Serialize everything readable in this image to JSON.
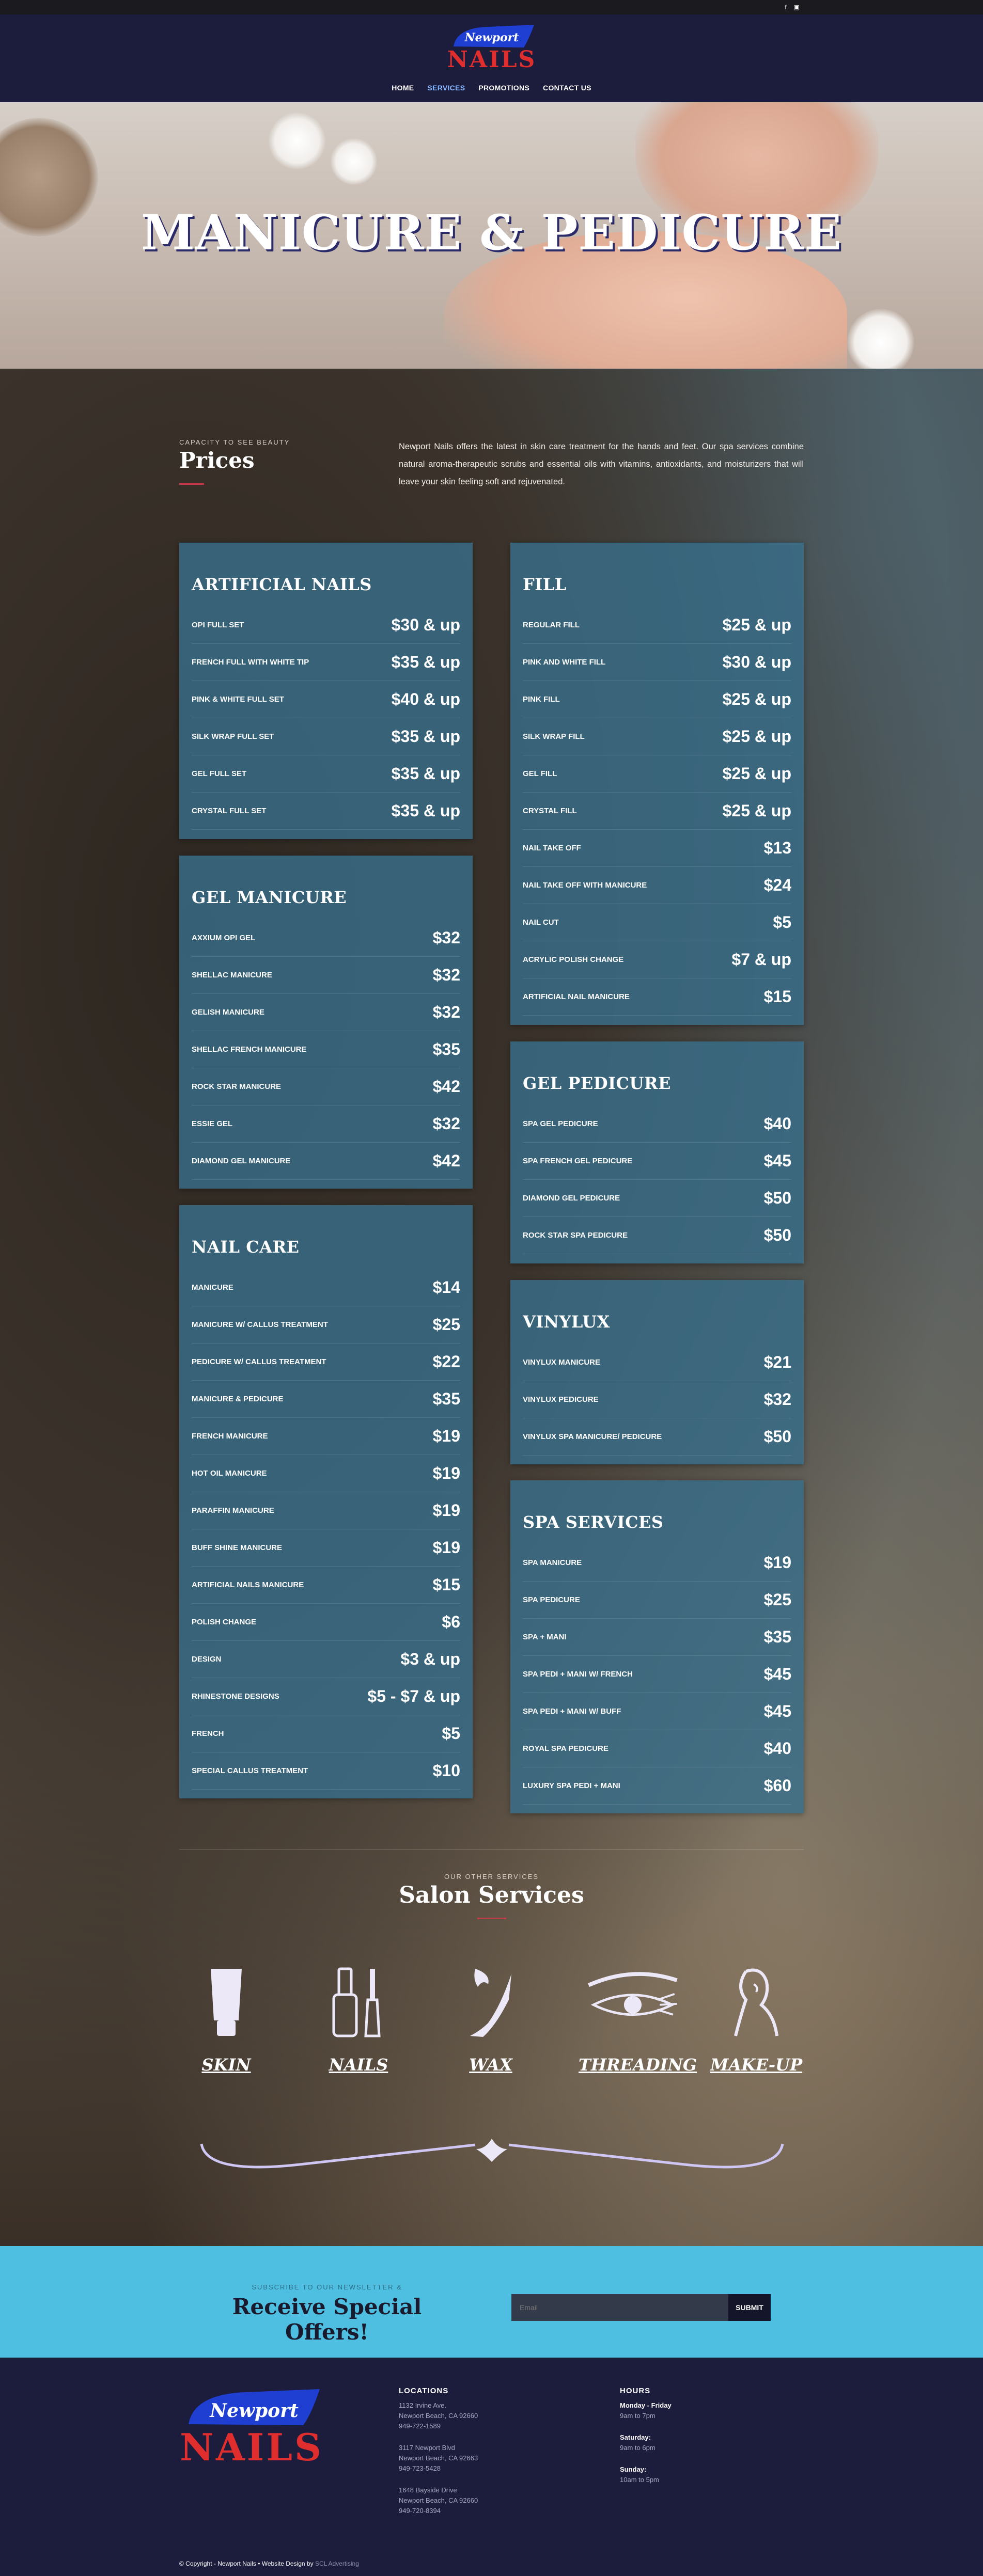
{
  "topbar": {
    "icons": [
      "facebook-icon",
      "instagram-icon"
    ]
  },
  "brand": {
    "logo_script": "Newport",
    "logo_word": "NAILS"
  },
  "nav": [
    {
      "label": "HOME",
      "active": false
    },
    {
      "label": "SERVICES",
      "active": true
    },
    {
      "label": "PROMOTIONS",
      "active": false
    },
    {
      "label": "CONTACT US",
      "active": false
    }
  ],
  "hero": {
    "title": "MANICURE & PEDICURE"
  },
  "intro": {
    "kicker": "CAPACITY TO SEE BEAUTY",
    "title": "Prices",
    "text": "Newport Nails offers the latest in skin care treatment for the hands and feet. Our spa services combine natural aroma-therapeutic scrubs and essential oils with vitamins, antioxidants, and moisturizers that will leave your skin feeling soft and rejuvenated."
  },
  "menus": {
    "artificial": {
      "title": "ARTIFICIAL NAILS",
      "items": [
        {
          "name": "OPI FULL SET",
          "price": "$30 & up"
        },
        {
          "name": "FRENCH FULL WITH WHITE TIP",
          "price": "$35 & up"
        },
        {
          "name": "PINK & WHITE FULL SET",
          "price": "$40 & up"
        },
        {
          "name": "SILK WRAP FULL SET",
          "price": "$35 & up"
        },
        {
          "name": "GEL FULL SET",
          "price": "$35 & up"
        },
        {
          "name": "CRYSTAL FULL SET",
          "price": "$35 & up"
        }
      ]
    },
    "gel_manicure": {
      "title": "GEL MANICURE",
      "items": [
        {
          "name": "AXXIUM OPI GEL",
          "price": "$32"
        },
        {
          "name": "SHELLAC MANICURE",
          "price": "$32"
        },
        {
          "name": "GELISH MANICURE",
          "price": "$32"
        },
        {
          "name": "SHELLAC FRENCH MANICURE",
          "price": "$35"
        },
        {
          "name": "ROCK STAR MANICURE",
          "price": "$42"
        },
        {
          "name": "ESSIE GEL",
          "price": "$32"
        },
        {
          "name": "DIAMOND GEL MANICURE",
          "price": "$42"
        }
      ]
    },
    "nail_care": {
      "title": "NAIL CARE",
      "items": [
        {
          "name": "MANICURE",
          "price": "$14"
        },
        {
          "name": "MANICURE W/ CALLUS TREATMENT",
          "price": "$25"
        },
        {
          "name": "PEDICURE W/ CALLUS TREATMENT",
          "price": "$22"
        },
        {
          "name": "MANICURE & PEDICURE",
          "price": "$35"
        },
        {
          "name": "FRENCH MANICURE",
          "price": "$19"
        },
        {
          "name": "HOT OIL MANICURE",
          "price": "$19"
        },
        {
          "name": "PARAFFIN MANICURE",
          "price": "$19"
        },
        {
          "name": "BUFF SHINE MANICURE",
          "price": "$19"
        },
        {
          "name": "ARTIFICIAL NAILS MANICURE",
          "price": "$15"
        },
        {
          "name": "POLISH CHANGE",
          "price": "$6"
        },
        {
          "name": "DESIGN",
          "price": "$3 & up"
        },
        {
          "name": "RHINESTONE DESIGNS",
          "price": "$5 - $7 & up"
        },
        {
          "name": "FRENCH",
          "price": "$5"
        },
        {
          "name": "SPECIAL CALLUS TREATMENT",
          "price": "$10"
        }
      ]
    },
    "fill": {
      "title": "FILL",
      "items": [
        {
          "name": "REGULAR FILL",
          "price": "$25 & up"
        },
        {
          "name": "PINK AND WHITE FILL",
          "price": "$30 & up"
        },
        {
          "name": "PINK FILL",
          "price": "$25 & up"
        },
        {
          "name": "SILK WRAP FILL",
          "price": "$25 & up"
        },
        {
          "name": "GEL FILL",
          "price": "$25 & up"
        },
        {
          "name": "CRYSTAL FILL",
          "price": "$25 & up"
        },
        {
          "name": "NAIL TAKE OFF",
          "price": "$13"
        },
        {
          "name": "NAIL TAKE OFF WITH MANICURE",
          "price": "$24"
        },
        {
          "name": "NAIL CUT",
          "price": "$5"
        },
        {
          "name": "ACRYLIC POLISH CHANGE",
          "price": "$7 & up"
        },
        {
          "name": "ARTIFICIAL NAIL MANICURE",
          "price": "$15"
        }
      ]
    },
    "gel_pedicure": {
      "title": "GEL PEDICURE",
      "items": [
        {
          "name": "SPA GEL PEDICURE",
          "price": "$40"
        },
        {
          "name": "SPA FRENCH GEL PEDICURE",
          "price": "$45"
        },
        {
          "name": "DIAMOND GEL PEDICURE",
          "price": "$50"
        },
        {
          "name": "ROCK STAR SPA PEDICURE",
          "price": "$50"
        }
      ]
    },
    "vinylux": {
      "title": "VINYLUX",
      "items": [
        {
          "name": "VINYLUX MANICURE",
          "price": "$21"
        },
        {
          "name": "VINYLUX PEDICURE",
          "price": "$32"
        },
        {
          "name": "VINYLUX SPA MANICURE/ PEDICURE",
          "price": "$50"
        }
      ]
    },
    "spa": {
      "title": "SPA SERVICES",
      "items": [
        {
          "name": "SPA MANICURE",
          "price": "$19"
        },
        {
          "name": "SPA PEDICURE",
          "price": "$25"
        },
        {
          "name": "SPA + MANI",
          "price": "$35"
        },
        {
          "name": "SPA PEDI + MANI W/ FRENCH",
          "price": "$45"
        },
        {
          "name": "SPA PEDI + MANI W/ BUFF",
          "price": "$45"
        },
        {
          "name": "ROYAL SPA PEDICURE",
          "price": "$40"
        },
        {
          "name": "LUXURY SPA PEDI + MANI",
          "price": "$60"
        }
      ]
    }
  },
  "salon": {
    "kicker": "OUR OTHER SERVICES",
    "title": "Salon Services",
    "services": [
      {
        "label": "SKIN",
        "icon": "skin-tube-icon"
      },
      {
        "label": "NAILS",
        "icon": "nail-polish-icon"
      },
      {
        "label": "WAX",
        "icon": "wax-leg-icon"
      },
      {
        "label": "THREADING",
        "icon": "eye-lash-icon"
      },
      {
        "label": "MAKE-UP",
        "icon": "makeup-face-icon"
      }
    ]
  },
  "newsletter": {
    "kicker": "SUBSCRIBE TO OUR NEWSLETTER &",
    "title": "Receive Special Offers!",
    "placeholder": "Email",
    "button": "SUBMIT"
  },
  "footer": {
    "locations_title": "LOCATIONS",
    "locations": [
      [
        "1132 Irvine Ave.",
        "Newport Beach, CA 92660",
        "949-722-1589"
      ],
      [
        "3117 Newport Blvd",
        "Newport Beach, CA 92663",
        "949-723-5428"
      ],
      [
        "1648 Bayside Drive",
        "Newport Beach, CA 92660",
        "949-720-8394"
      ]
    ],
    "hours_title": "HOURS",
    "hours": [
      {
        "day": "Monday - Friday",
        "time": "9am to 7pm"
      },
      {
        "day": "Saturday:",
        "time": "9am to 6pm"
      },
      {
        "day": "Sunday:",
        "time": "10am to 5pm"
      }
    ],
    "copyright_main": "© Copyright - Newport Nails • Website Design by",
    "copyright_link": "SCL Advertising"
  },
  "colors": {
    "navy": "#1c1c3c",
    "accent_red": "#c73a4b",
    "card_blue": "#386e8a",
    "newsletter": "#4ebfe0"
  }
}
